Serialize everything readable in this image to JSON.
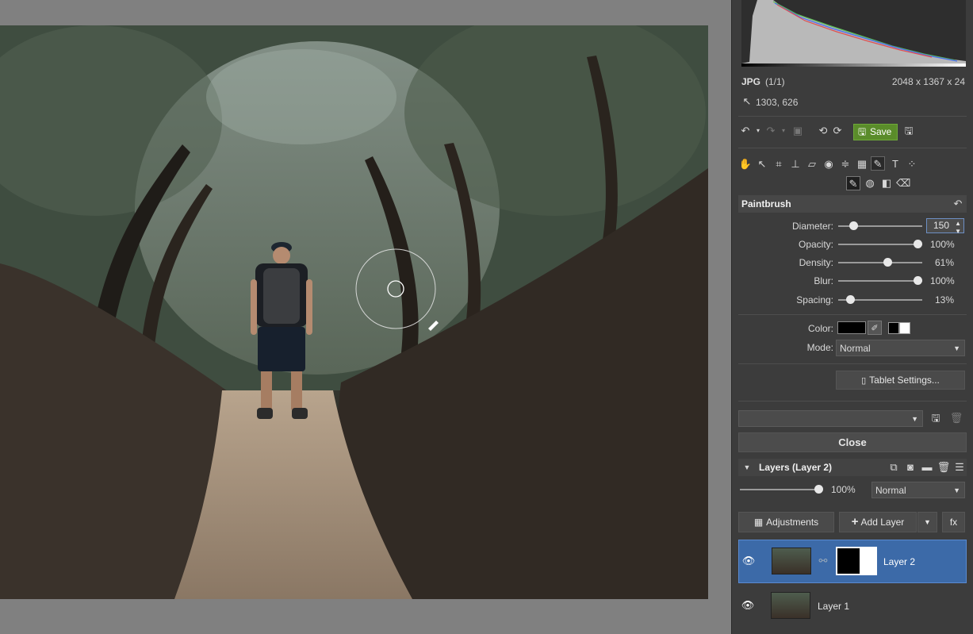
{
  "histogram": {
    "format": "JPG",
    "page": "(1/1)",
    "dimensions": "2048 x 1367 x 24",
    "cursor_pos": "1303, 626"
  },
  "toolbar": {
    "save_label": "Save"
  },
  "paintbrush": {
    "title": "Paintbrush",
    "diameter_label": "Diameter:",
    "diameter_value": "150",
    "diameter_level": 0.19,
    "opacity_label": "Opacity:",
    "opacity_value": "100%",
    "opacity_level": 1.0,
    "density_label": "Density:",
    "density_value": "61%",
    "density_level": 0.61,
    "blur_label": "Blur:",
    "blur_value": "100%",
    "blur_level": 1.0,
    "spacing_label": "Spacing:",
    "spacing_value": "13%",
    "spacing_level": 0.13,
    "color_label": "Color:",
    "color_value": "#000000",
    "mode_label": "Mode:",
    "mode_value": "Normal",
    "tablet_label": "Tablet Settings..."
  },
  "close_label": "Close",
  "layers": {
    "title": "Layers (Layer 2)",
    "opacity_value": "100%",
    "opacity_level": 1.0,
    "blend_mode": "Normal",
    "adjustments_label": "Adjustments",
    "add_layer_label": "Add Layer",
    "fx_label": "fx",
    "items": [
      {
        "name": "Layer 2",
        "selected": true
      },
      {
        "name": "Layer 1",
        "selected": false
      }
    ]
  },
  "colors": {
    "panel_bg": "#3c3c3c",
    "selected_layer": "#3c6aa8",
    "save_green": "#5a8c2a"
  }
}
